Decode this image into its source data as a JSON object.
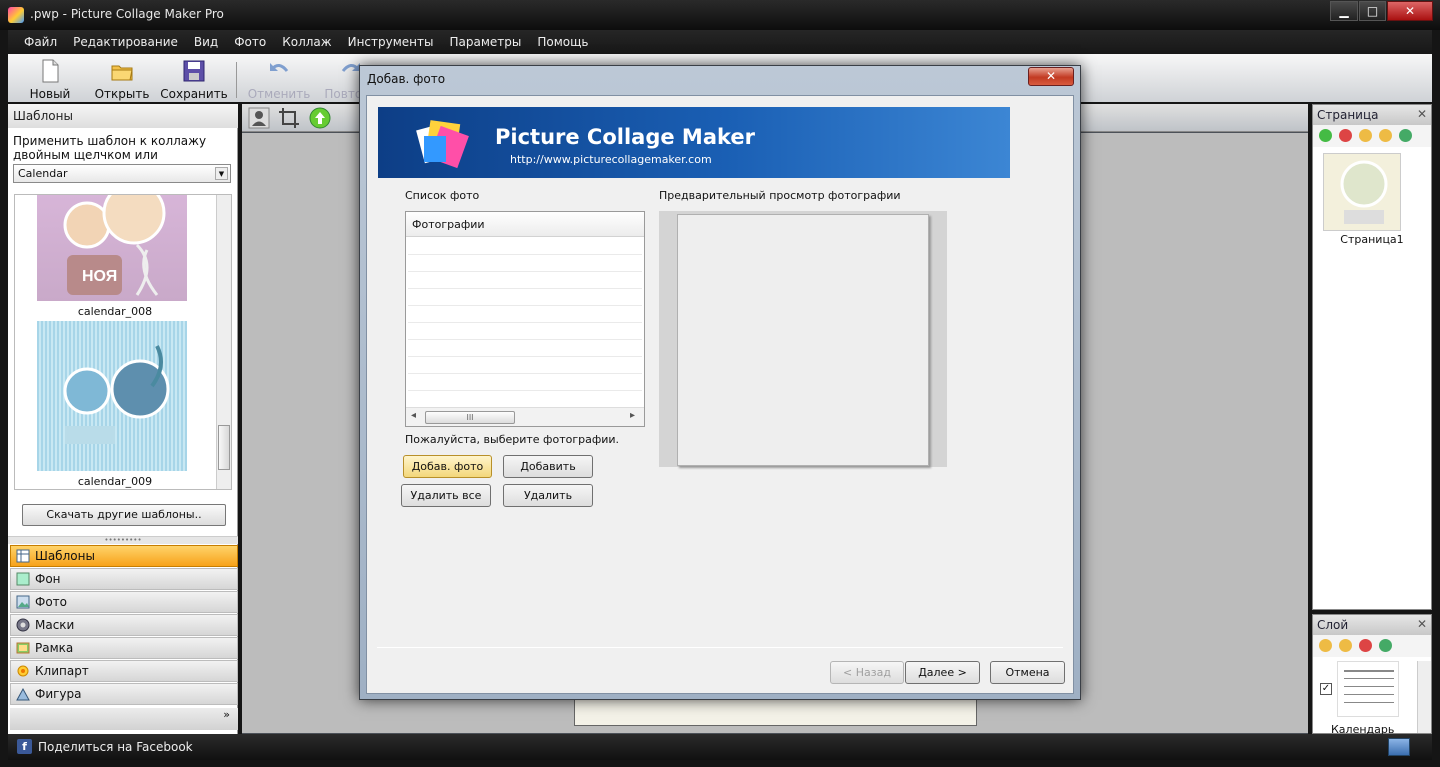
{
  "window": {
    "title": ".pwp - Picture Collage Maker Pro",
    "minimize": "▁",
    "maximize": "□",
    "close": "✕"
  },
  "menu": [
    "Файл",
    "Редактирование",
    "Вид",
    "Фото",
    "Коллаж",
    "Инструменты",
    "Параметры",
    "Помощь"
  ],
  "toolbar": {
    "new": "Новый",
    "open": "Открыть",
    "save": "Сохранить",
    "undo": "Отменить",
    "redo": "Повтори"
  },
  "left_panel": {
    "title": "Шаблоны",
    "hint": "Применить шаблон к коллажу двойным щелчком или",
    "combo_value": "Calendar",
    "templates": [
      {
        "name": "calendar_008"
      },
      {
        "name": "calendar_009"
      }
    ],
    "thumb_text": "НОЯ",
    "download_button": "Скачать другие шаблоны..",
    "splitter": "•••••••••",
    "more": "»",
    "nav": [
      {
        "label": "Шаблоны",
        "icon": "templates-icon",
        "selected": true
      },
      {
        "label": "Фон",
        "icon": "background-icon",
        "selected": false
      },
      {
        "label": "Фото",
        "icon": "photo-icon",
        "selected": false
      },
      {
        "label": "Маски",
        "icon": "mask-icon",
        "selected": false
      },
      {
        "label": "Рамка",
        "icon": "frame-icon",
        "selected": false
      },
      {
        "label": "Клипарт",
        "icon": "clipart-icon",
        "selected": false
      },
      {
        "label": "Фигура",
        "icon": "shape-icon",
        "selected": false
      }
    ]
  },
  "page_panel": {
    "title": "Страница",
    "close": "✕",
    "pages": [
      {
        "label": "Страница1"
      }
    ]
  },
  "layer_panel": {
    "title": "Слой",
    "close": "✕",
    "layers": [
      {
        "label": "Календарь",
        "checked": true
      }
    ]
  },
  "statusbar": {
    "facebook_text": "Поделиться на Facebook",
    "fb_glyph": "f"
  },
  "dialog": {
    "title": "Добав. фото",
    "close": "✕",
    "banner_title": "Picture Collage Maker",
    "banner_url": "http://www.picturecollagemaker.com",
    "photo_list_label": "Список фото",
    "photo_list_header": "Фотографии",
    "scroll_grip": "III",
    "scroll_left": "◂",
    "scroll_right": "▸",
    "preview_label": "Предварительный просмотр фотографии",
    "hint": "Пожалуйста, выберите фотографии.",
    "buttons": {
      "add_photo": "Добав. фото",
      "add_folder": "Добавить папку",
      "remove_all": "Удалить все",
      "remove": "Удалить",
      "back": "< Назад",
      "next": "Далее >",
      "cancel": "Отмена"
    }
  },
  "colors": {
    "accent_selected": "#f7a21a",
    "banner_blue": "#1a5fb4",
    "facebook": "#3b5998"
  }
}
